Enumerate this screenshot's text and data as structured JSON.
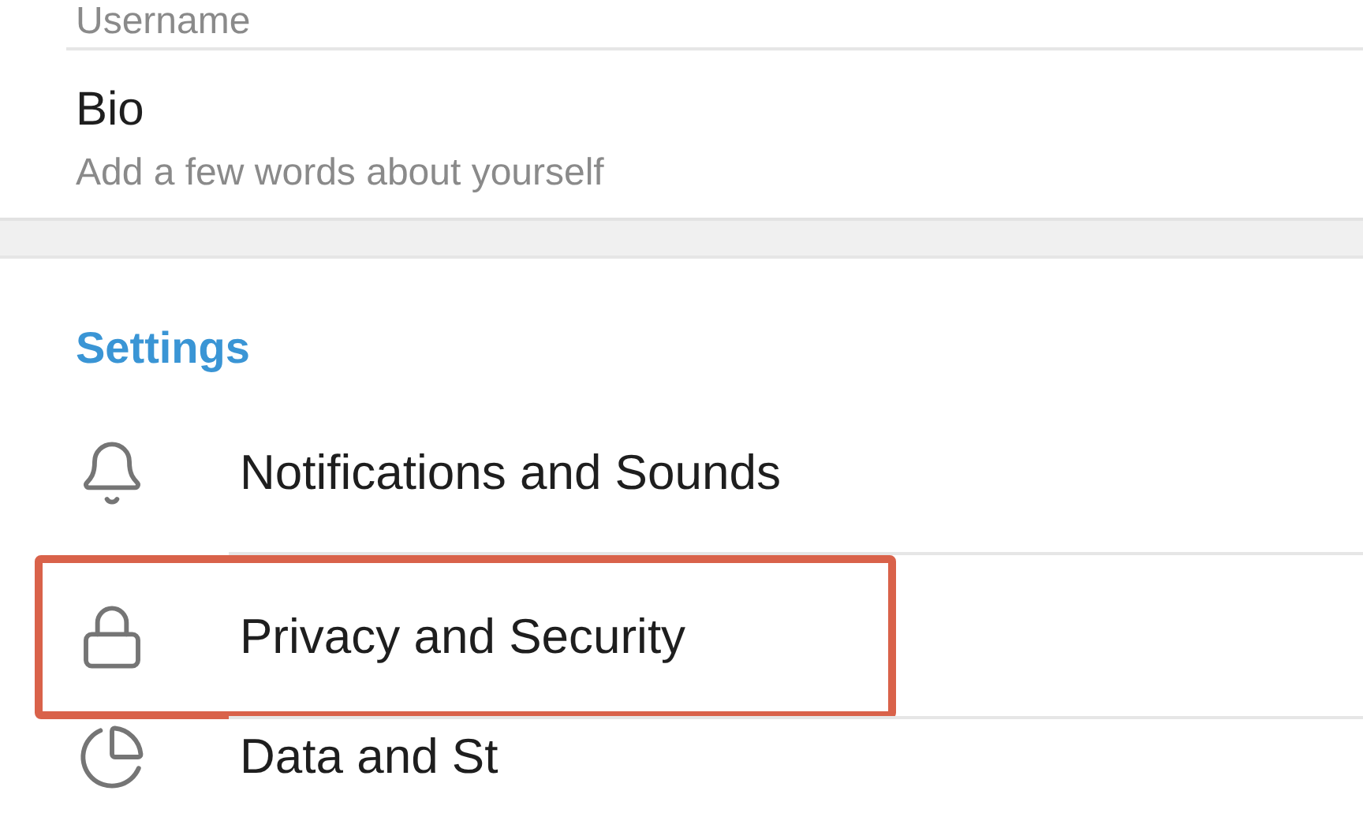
{
  "profile": {
    "username": {
      "label": "Username"
    },
    "bio": {
      "title": "Bio",
      "subtitle": "Add a few words about yourself"
    }
  },
  "settings": {
    "title": "Settings",
    "items": [
      {
        "kind": "bell",
        "label": "Notifications and Sounds",
        "highlighted": false
      },
      {
        "kind": "lock",
        "label": "Privacy and Security",
        "highlighted": true
      },
      {
        "kind": "pie",
        "label": "Data and St",
        "highlighted": false
      }
    ]
  }
}
